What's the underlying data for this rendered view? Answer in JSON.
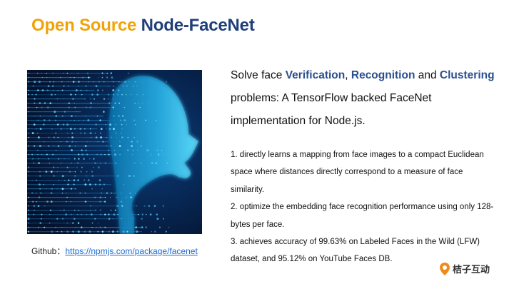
{
  "slide": {
    "title_part1": "Open Source",
    "title_part2": "Node-FaceNet"
  },
  "lead": {
    "t1": "Solve face ",
    "k1": "Verification",
    "t2": ", ",
    "k2": "Recognition",
    "t3": " and ",
    "k3": "Clustering",
    "t4": " problems: A TensorFlow backed FaceNet implementation for Node.js."
  },
  "points": [
    "1. directly learns a mapping from face images to a compact Euclidean space where distances directly correspond to a measure of face similarity.",
    "2. optimize the embedding face recognition performance using only 128-bytes per face.",
    "3. achieves accuracy of 99.63% on Labeled Faces in the Wild (LFW) dataset, and 95.12% on YouTube Faces DB."
  ],
  "github": {
    "label": "Github：",
    "url": "https://npmjs.com/package/facenet"
  },
  "brand": {
    "name": "桔子互动"
  },
  "colors": {
    "accent_orange": "#F0A30A",
    "accent_navy": "#1F3F7A",
    "keyword_blue": "#2A4F8E",
    "link_blue": "#1a6ad0",
    "hero_bg": "#04122e",
    "hero_glow": "#36c4f0"
  }
}
